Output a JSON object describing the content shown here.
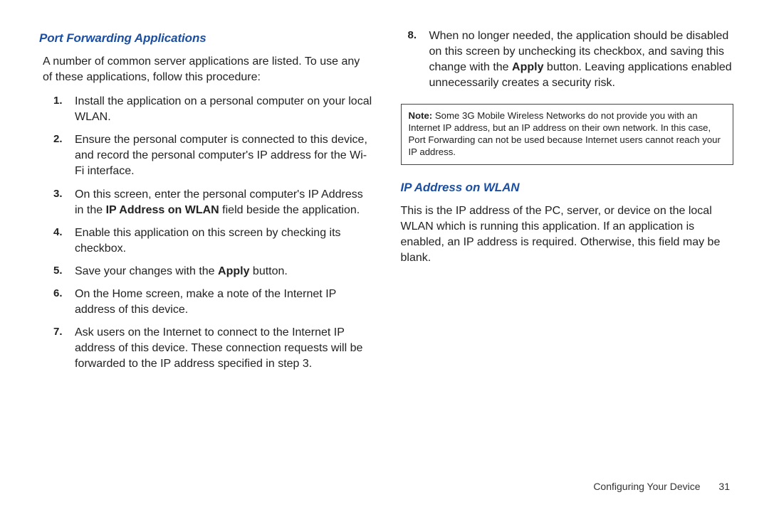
{
  "left": {
    "heading": "Port Forwarding Applications",
    "intro": "A number of common server applications are listed. To use any of these applications, follow this procedure:",
    "steps": {
      "s1": "Install the application on a personal computer on your local WLAN.",
      "s2": "Ensure the personal computer is connected to this device, and record the personal computer's IP address for the Wi-Fi interface.",
      "s3a": "On this screen, enter the personal computer's IP Address in the ",
      "s3b": "IP Address on WLAN",
      "s3c": " field beside the application.",
      "s4": "Enable this application on this screen by checking its checkbox.",
      "s5a": "Save your changes with the ",
      "s5b": "Apply",
      "s5c": " button.",
      "s6": "On the Home screen, make a note of the Internet IP address of this device.",
      "s7": "Ask users on the Internet to connect to the Internet IP address of this device. These connection requests will be forwarded to the IP address specified in step 3."
    }
  },
  "right": {
    "step8a": "When no longer needed, the application should be disabled on this screen by unchecking its checkbox, and saving this change with the ",
    "step8b": "Apply",
    "step8c": " button. Leaving applications enabled unnecessarily creates a security risk.",
    "note_label": "Note:",
    "note_body": "Some 3G Mobile Wireless Networks do not provide you with an Internet IP address, but an IP address on their own network. In this case, Port Forwarding can not be used because Internet users cannot reach your IP address.",
    "heading2": "IP Address on WLAN",
    "para2": "This is the IP address of the PC, server, or device on the local WLAN which is running this application. If an application is enabled, an IP address is required. Otherwise, this field may be blank."
  },
  "footer": {
    "section": "Configuring Your Device",
    "page": "31"
  }
}
